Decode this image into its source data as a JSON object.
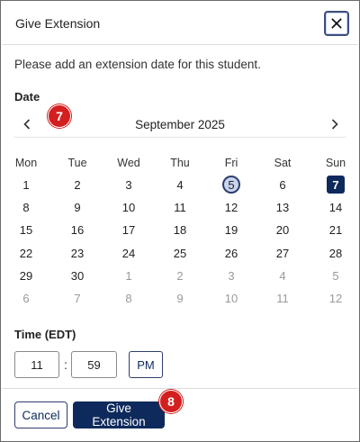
{
  "dialog": {
    "title": "Give Extension",
    "close_icon": "close-icon"
  },
  "intro": "Please add an extension date for this student.",
  "date_label": "Date",
  "badges": {
    "step1": "7",
    "step2": "8"
  },
  "calendar": {
    "month": "September 2025",
    "prev_icon": "chevron-left-icon",
    "next_icon": "chevron-right-icon",
    "weekdays": [
      "Mon",
      "Tue",
      "Wed",
      "Thu",
      "Fri",
      "Sat",
      "Sun"
    ],
    "weeks": [
      [
        "1",
        "2",
        "3",
        "4",
        "5",
        "6",
        "7"
      ],
      [
        "8",
        "9",
        "10",
        "11",
        "12",
        "13",
        "14"
      ],
      [
        "15",
        "16",
        "17",
        "18",
        "19",
        "20",
        "21"
      ],
      [
        "22",
        "23",
        "24",
        "25",
        "26",
        "27",
        "28"
      ],
      [
        "29",
        "30",
        "1",
        "2",
        "3",
        "4",
        "5"
      ],
      [
        "6",
        "7",
        "8",
        "9",
        "10",
        "11",
        "12"
      ]
    ],
    "today": "5",
    "selected": "7"
  },
  "time": {
    "label": "Time (EDT)",
    "hour": "11",
    "separator": ":",
    "minute": "59",
    "period": "PM"
  },
  "footer": {
    "cancel_label": "Cancel",
    "give_label": "Give Extension"
  },
  "colors": {
    "primary": "#0e2a5c",
    "badge": "#d31f1f",
    "today_fill": "#c9d5ee"
  }
}
